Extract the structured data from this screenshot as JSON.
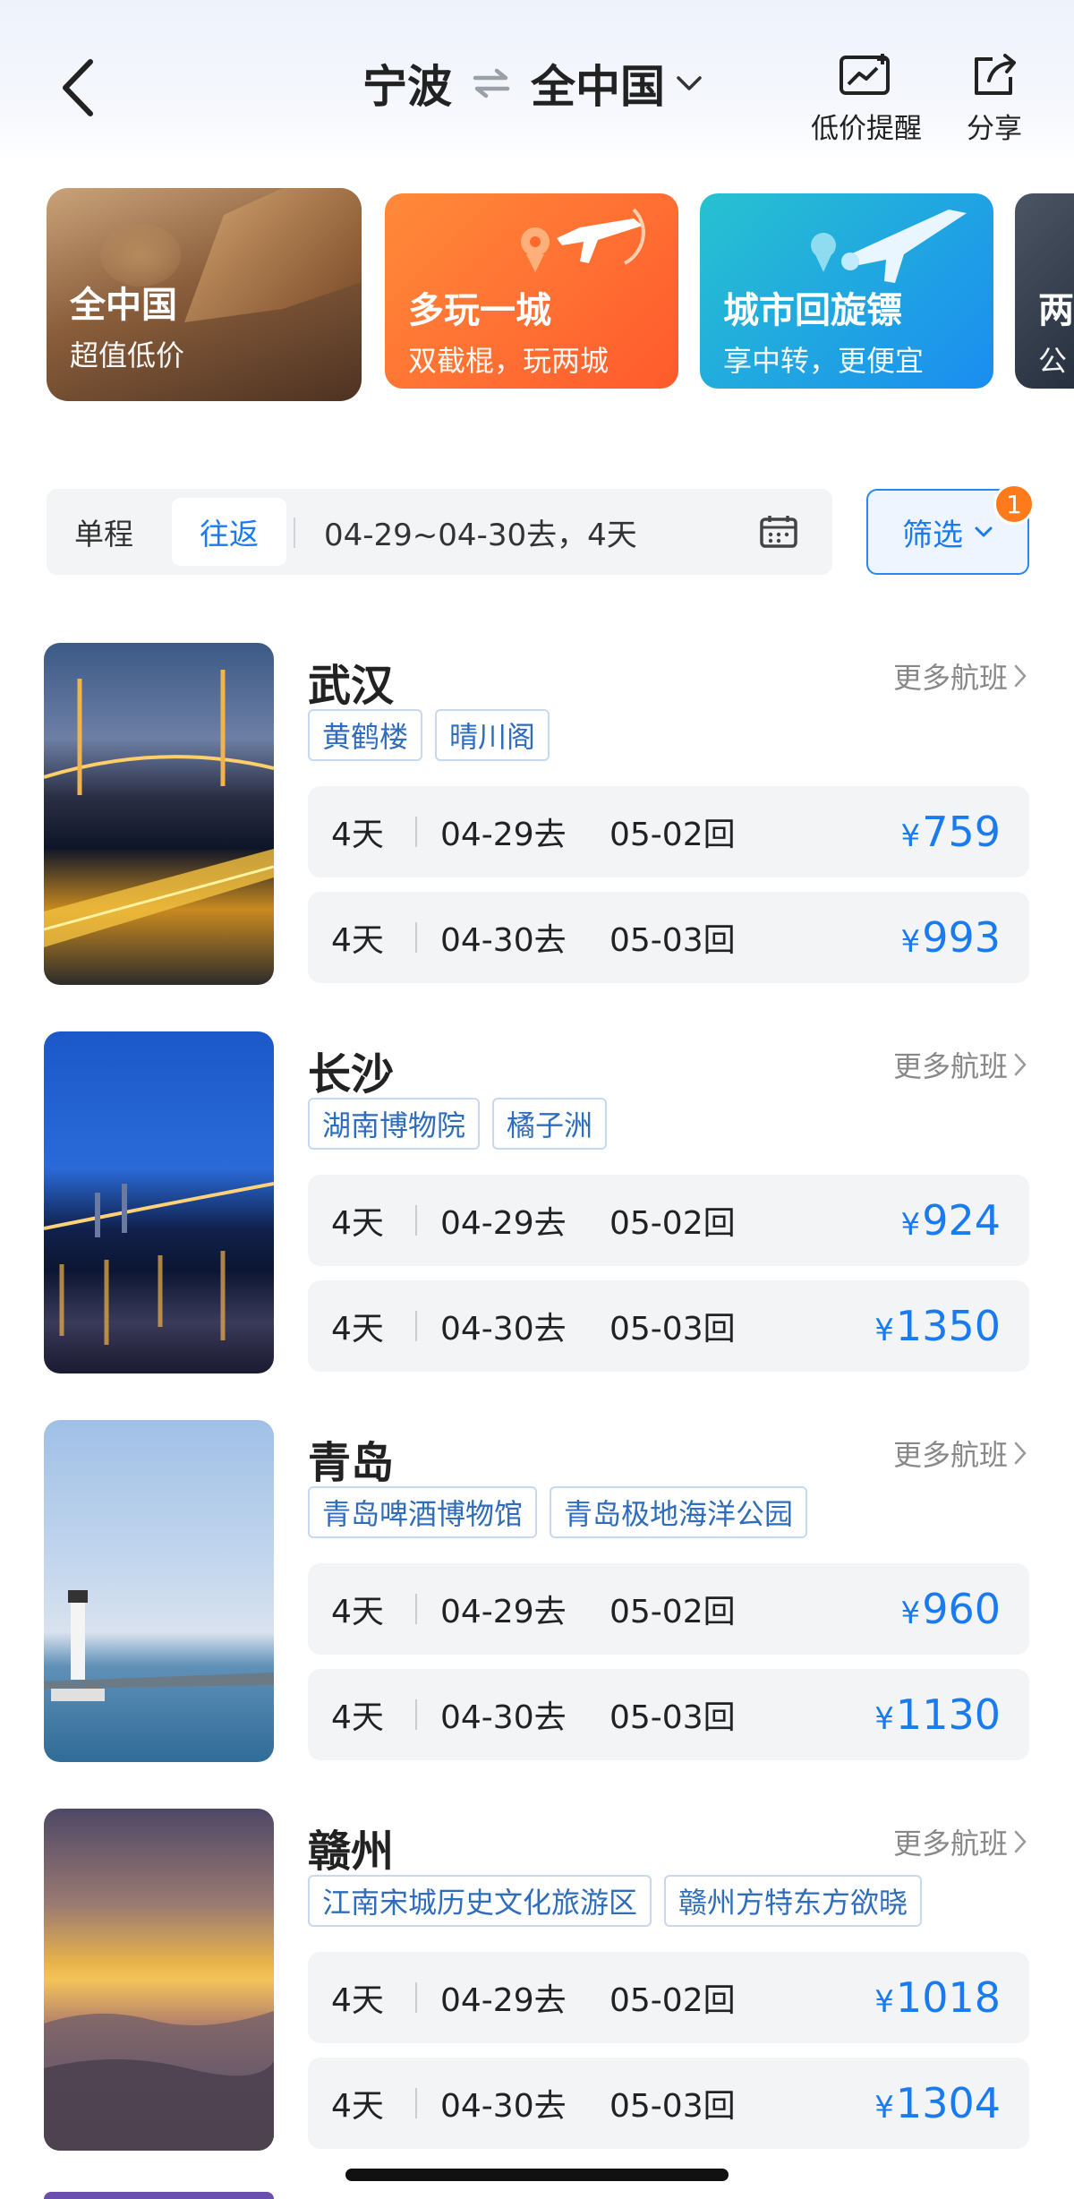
{
  "header": {
    "origin": "宁波",
    "destination": "全中国",
    "actions": [
      {
        "label": "低价提醒",
        "icon": "price-alert-icon"
      },
      {
        "label": "分享",
        "icon": "share-icon"
      }
    ]
  },
  "banners": [
    {
      "title": "全中国",
      "subtitle": "超值低价"
    },
    {
      "title": "多玩一城",
      "subtitle": "双截棍，玩两城"
    },
    {
      "title": "城市回旋镖",
      "subtitle": "享中转，更便宜"
    },
    {
      "title": "两",
      "subtitle": "公"
    }
  ],
  "search": {
    "one_way": "单程",
    "round_trip": "往返",
    "dates": "04-29~04-30去，4天",
    "filter_label": "筛选",
    "filter_badge": "1"
  },
  "more_label": "更多航班",
  "destinations": [
    {
      "city": "武汉",
      "tags": [
        "黄鹤楼",
        "晴川阁"
      ],
      "options": [
        {
          "days": "4天",
          "go": "04-29去",
          "back": "05-02回",
          "currency": "¥",
          "price": "759"
        },
        {
          "days": "4天",
          "go": "04-30去",
          "back": "05-03回",
          "currency": "¥",
          "price": "993"
        }
      ]
    },
    {
      "city": "长沙",
      "tags": [
        "湖南博物院",
        "橘子洲"
      ],
      "options": [
        {
          "days": "4天",
          "go": "04-29去",
          "back": "05-02回",
          "currency": "¥",
          "price": "924"
        },
        {
          "days": "4天",
          "go": "04-30去",
          "back": "05-03回",
          "currency": "¥",
          "price": "1350"
        }
      ]
    },
    {
      "city": "青岛",
      "tags": [
        "青岛啤酒博物馆",
        "青岛极地海洋公园"
      ],
      "options": [
        {
          "days": "4天",
          "go": "04-29去",
          "back": "05-02回",
          "currency": "¥",
          "price": "960"
        },
        {
          "days": "4天",
          "go": "04-30去",
          "back": "05-03回",
          "currency": "¥",
          "price": "1130"
        }
      ]
    },
    {
      "city": "赣州",
      "tags": [
        "江南宋城历史文化旅游区",
        "赣州方特东方欲晓"
      ],
      "options": [
        {
          "days": "4天",
          "go": "04-29去",
          "back": "05-02回",
          "currency": "¥",
          "price": "1018"
        },
        {
          "days": "4天",
          "go": "04-30去",
          "back": "05-03回",
          "currency": "¥",
          "price": "1304"
        }
      ]
    }
  ]
}
